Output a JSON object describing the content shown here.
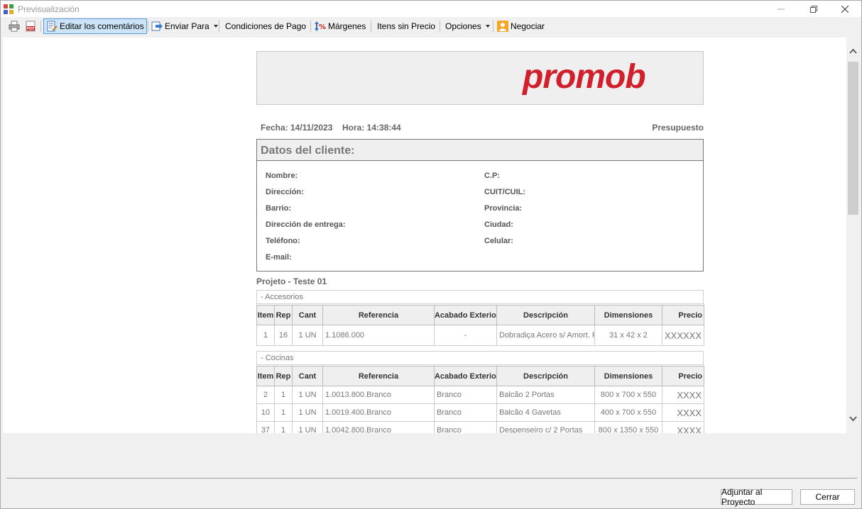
{
  "window": {
    "title": "Previsualización"
  },
  "toolbar": {
    "items": [
      {
        "label": "Editar los comentários",
        "icon": "edit-notes-icon"
      },
      {
        "label": "Enviar Para",
        "icon": "send-icon"
      },
      {
        "label": "Condiciones de Pago"
      },
      {
        "label": "Márgenes",
        "icon": "margins-icon"
      },
      {
        "label": "Itens sin Precio"
      },
      {
        "label": "Opciones"
      },
      {
        "label": "Negociar",
        "icon": "negotiate-icon"
      }
    ]
  },
  "report": {
    "logo_text": "promob",
    "date_label": "Fecha: 14/11/2023",
    "time_label": "Hora: 14:38:44",
    "doc_type": "Presupuesto",
    "client": {
      "title": "Datos del cliente:",
      "left_fields": [
        "Nombre:",
        "Dirección:",
        "Barrio:",
        "Dirección de entrega:",
        "Teléfono:",
        "E-mail:"
      ],
      "right_fields": [
        "C.P:",
        "CUIT/CUIL:",
        "Provincia:",
        "Ciudad:",
        "Celular:"
      ]
    },
    "project_title": "Projeto - Teste 01",
    "columns": [
      "Item",
      "Rep",
      "Cant",
      "Referencia",
      "Acabado Exterior",
      "Descripción",
      "Dimensiones",
      "Precio"
    ],
    "sections": [
      {
        "name": "- Accesorios",
        "rows": [
          [
            "1",
            "16",
            "1 UN",
            "1.1086.000",
            "-",
            "Dobradiça Acero s/ Amort. Reta / Baixa",
            "31 x 42 x 2",
            "XXXXXX"
          ]
        ]
      },
      {
        "name": "- Cocinas",
        "rows": [
          [
            "2",
            "1",
            "1 UN",
            "1.0013.800.Branco",
            "Branco",
            "Balcão 2 Portas",
            "800 x 700 x 550",
            "XXXX"
          ],
          [
            "10",
            "1",
            "1 UN",
            "1.0019.400.Branco",
            "Branco",
            "Balcão 4 Gavetas",
            "400 x 700 x 550",
            "XXXX"
          ],
          [
            "37",
            "1",
            "1 UN",
            "1.0042.800.Branco",
            "Branco",
            "Despenseiro c/ 2 Portas",
            "800 x 1350 x 550",
            "XXXX"
          ]
        ]
      }
    ]
  },
  "buttons": {
    "attach": "Adjuntar al Proyecto",
    "close": "Cerrar"
  },
  "colors": {
    "logo": "#d0202c",
    "active_button_bg": "#cce4f7",
    "active_button_border": "#5a9bd5"
  }
}
